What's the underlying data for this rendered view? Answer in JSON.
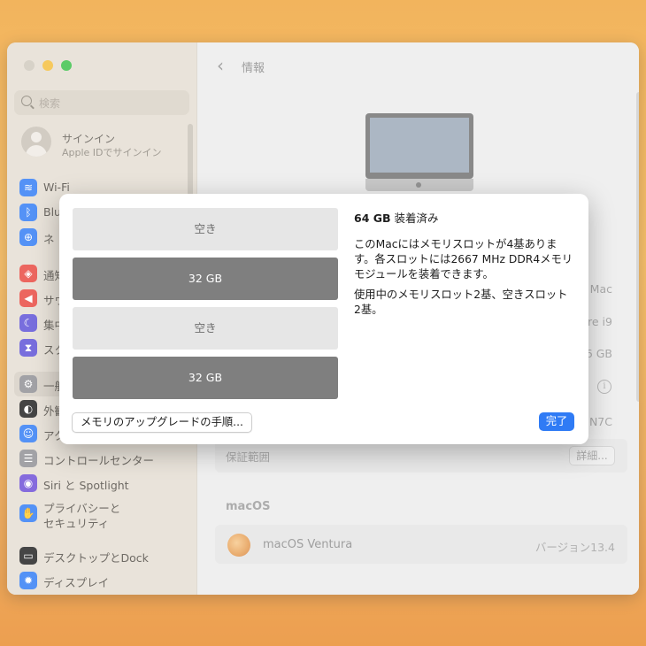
{
  "window": {
    "search": {
      "placeholder": "検索"
    },
    "account": {
      "title": "サインイン",
      "subtitle": "Apple IDでサインイン"
    },
    "sidebar": {
      "items": [
        {
          "label": "Wi-Fi",
          "icon": "wifi-icon",
          "color": "#2f7bf5"
        },
        {
          "label": "Blu",
          "icon": "bluetooth-icon",
          "color": "#2f7bf5"
        },
        {
          "label": "ネ",
          "icon": "network-icon",
          "color": "#2f7bf5"
        },
        {
          "label": "通知",
          "icon": "bell-icon",
          "color": "#e8453c"
        },
        {
          "label": "サウ",
          "icon": "speaker-icon",
          "color": "#e8453c"
        },
        {
          "label": "集中",
          "icon": "moon-icon",
          "color": "#5b4fd6"
        },
        {
          "label": "スク",
          "icon": "hourglass-icon",
          "color": "#5b4fd6"
        },
        {
          "label": "一般",
          "icon": "gear-icon",
          "color": "#8e8e93"
        },
        {
          "label": "外観",
          "icon": "appearance-icon",
          "color": "#1d1d1d"
        },
        {
          "label": "アク",
          "icon": "accessibility-icon",
          "color": "#2f7bf5"
        },
        {
          "label": "コントロールセンター",
          "icon": "control-center-icon",
          "color": "#8e8e93"
        },
        {
          "label": "Siri と Spotlight",
          "icon": "siri-icon",
          "color": "#6b4bd6"
        },
        {
          "label": "プライバシーと",
          "label2": "セキュリティ",
          "icon": "hand-icon",
          "color": "#2f7bf5"
        },
        {
          "label": "デスクトップとDock",
          "icon": "desktop-icon",
          "color": "#1d1d1d"
        },
        {
          "label": "ディスプレイ",
          "icon": "display-icon",
          "color": "#2f7bf5"
        }
      ]
    },
    "main": {
      "title": "情報",
      "rows": {
        "model": "Mac",
        "chip": "re i9",
        "memory": "6 GB",
        "serial": "N7C",
        "warranty": "保証範囲",
        "warranty_button": "詳細..."
      },
      "macos_section": "macOS",
      "macos_name": "macOS Ventura",
      "macos_version": "バージョン13.4"
    }
  },
  "dialog": {
    "slots": [
      {
        "label": "空き",
        "state": "empty"
      },
      {
        "label": "32 GB",
        "state": "full"
      },
      {
        "label": "空き",
        "state": "empty"
      },
      {
        "label": "32 GB",
        "state": "full"
      }
    ],
    "installed_amount": "64 GB",
    "installed_label": "装着済み",
    "paragraph1_line1": "このMacにはメモリスロットが4基ありま",
    "paragraph1_line2": "す。各スロットには2667 MHz DDR4メモリ",
    "paragraph1_line3": "モジュールを装着できます。",
    "paragraph2_line1": "使用中のメモリスロット2基、空きスロット",
    "paragraph2_line2": "2基。",
    "upgrade_button": "メモリのアップグレードの手順...",
    "done_button": "完了",
    "accent_color": "#2f7bf5"
  }
}
